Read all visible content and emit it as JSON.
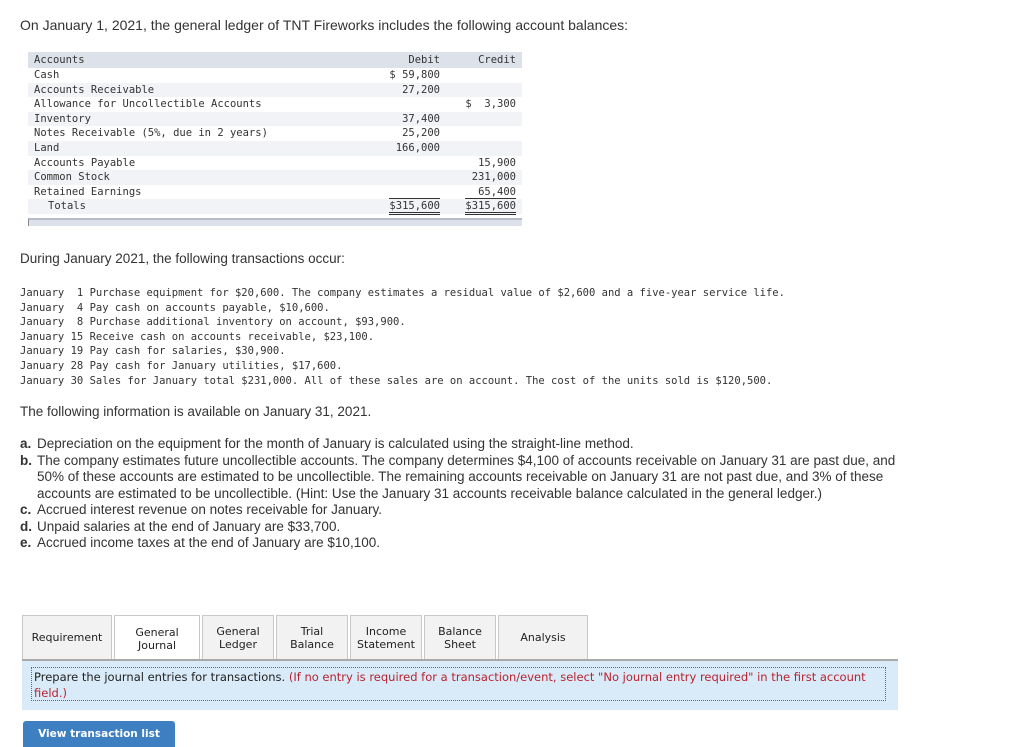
{
  "intro": "On January 1, 2021, the general ledger of TNT Fireworks includes the following account balances:",
  "ledger": {
    "headers": [
      "Accounts",
      "Debit",
      "Credit"
    ],
    "rows": [
      {
        "account": "Cash",
        "debit": "$ 59,800",
        "credit": ""
      },
      {
        "account": "Accounts Receivable",
        "debit": "27,200",
        "credit": ""
      },
      {
        "account": "Allowance for Uncollectible Accounts",
        "debit": "",
        "credit": "$  3,300"
      },
      {
        "account": "Inventory",
        "debit": "37,400",
        "credit": ""
      },
      {
        "account": "Notes Receivable (5%, due in 2 years)",
        "debit": "25,200",
        "credit": ""
      },
      {
        "account": "Land",
        "debit": "166,000",
        "credit": ""
      },
      {
        "account": "Accounts Payable",
        "debit": "",
        "credit": "15,900"
      },
      {
        "account": "Common Stock",
        "debit": "",
        "credit": "231,000"
      },
      {
        "account": "Retained Earnings",
        "debit": "",
        "credit": "65,400"
      }
    ],
    "totals": {
      "label": "Totals",
      "debit": "$315,600",
      "credit": "$315,600"
    }
  },
  "during": "During January 2021, the following transactions occur:",
  "transactions": [
    {
      "month": "January",
      "day": " 1",
      "text": "Purchase equipment for $20,600. The company estimates a residual value of $2,600 and a five-year service life."
    },
    {
      "month": "January",
      "day": " 4",
      "text": "Pay cash on accounts payable, $10,600."
    },
    {
      "month": "January",
      "day": " 8",
      "text": "Purchase additional inventory on account, $93,900."
    },
    {
      "month": "January",
      "day": "15",
      "text": "Receive cash on accounts receivable, $23,100."
    },
    {
      "month": "January",
      "day": "19",
      "text": "Pay cash for salaries, $30,900."
    },
    {
      "month": "January",
      "day": "28",
      "text": "Pay cash for January utilities, $17,600."
    },
    {
      "month": "January",
      "day": "30",
      "text": "Sales for January total $231,000. All of these sales are on account. The cost of the units sold is $120,500."
    }
  ],
  "info": "The following information is available on January 31, 2021.",
  "items": [
    {
      "label": "a.",
      "text": "Depreciation on the equipment for the month of January is calculated using the straight-line method."
    },
    {
      "label": "b.",
      "text": "The company estimates future uncollectible accounts. The company determines $4,100 of accounts receivable on January 31 are past due, and 50% of these accounts are estimated to be uncollectible. The remaining accounts receivable on January 31 are not past due, and 3% of these accounts are estimated to be uncollectible. (Hint: Use the January 31 accounts receivable balance calculated in the general ledger.)"
    },
    {
      "label": "c.",
      "text": "Accrued interest revenue on notes receivable for January."
    },
    {
      "label": "d.",
      "text": "Unpaid salaries at the end of January are $33,700."
    },
    {
      "label": "e.",
      "text": "Accrued income taxes at the end of January are $10,100."
    }
  ],
  "tabs": [
    {
      "label": "Requirement",
      "active": false
    },
    {
      "label": "General Journal",
      "active": true
    },
    {
      "label": "General Ledger",
      "active": false
    },
    {
      "label": "Trial Balance",
      "active": false
    },
    {
      "label": "Income Statement",
      "active": false
    },
    {
      "label": "Balance Sheet",
      "active": false
    },
    {
      "label": "Analysis",
      "active": false
    }
  ],
  "instruction": {
    "main": "Prepare the journal entries for transactions. ",
    "note": "(If no entry is required for a transaction/event, select \"No journal entry required\" in the first account field.)"
  },
  "view_button": "View transaction list",
  "colors": {
    "accent": "#3d7fc1",
    "note": "#b8232f",
    "instr_bg": "#d9ebf9"
  }
}
